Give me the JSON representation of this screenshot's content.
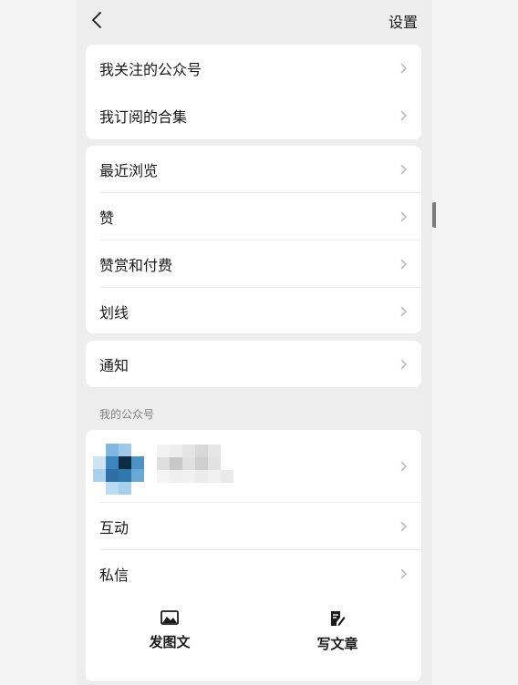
{
  "header": {
    "settings_label": "设置"
  },
  "group_subscriptions": {
    "items": [
      {
        "label": "我关注的公众号"
      },
      {
        "label": "我订阅的合集"
      }
    ]
  },
  "group_activity": {
    "items": [
      {
        "label": "最近浏览"
      },
      {
        "label": "赞"
      },
      {
        "label": "赞赏和付费"
      },
      {
        "label": "划线"
      }
    ]
  },
  "group_notify": {
    "items": [
      {
        "label": "通知"
      }
    ]
  },
  "my_account": {
    "section_title": "我的公众号",
    "items": [
      {
        "label": "互动"
      },
      {
        "label": "私信"
      }
    ],
    "actions": [
      {
        "label": "发图文",
        "icon": "image-icon"
      },
      {
        "label": "写文章",
        "icon": "edit-document-icon"
      }
    ]
  },
  "colors": {
    "background": "#ededed",
    "card": "#ffffff",
    "text": "#191919",
    "secondary_text": "#7f7f7f",
    "chevron": "#b2b2b2"
  }
}
